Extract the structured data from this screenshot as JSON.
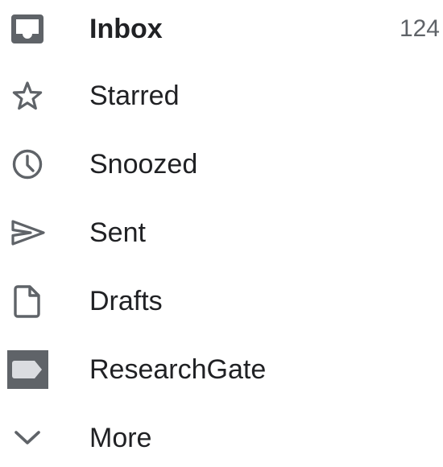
{
  "nav": {
    "items": [
      {
        "id": "inbox",
        "label": "Inbox",
        "icon": "inbox-icon",
        "count": "124",
        "active": true
      },
      {
        "id": "starred",
        "label": "Starred",
        "icon": "star-outline-icon"
      },
      {
        "id": "snoozed",
        "label": "Snoozed",
        "icon": "clock-icon"
      },
      {
        "id": "sent",
        "label": "Sent",
        "icon": "send-icon"
      },
      {
        "id": "drafts",
        "label": "Drafts",
        "icon": "draft-document-icon"
      },
      {
        "id": "researchgate",
        "label": "ResearchGate",
        "icon": "label-tag-icon",
        "label_color": "#5f6368"
      },
      {
        "id": "more",
        "label": "More",
        "icon": "chevron-down-icon"
      }
    ]
  },
  "colors": {
    "text": "#202124",
    "icon": "#5f6368",
    "count": "#5f6368",
    "background": "#ffffff"
  }
}
